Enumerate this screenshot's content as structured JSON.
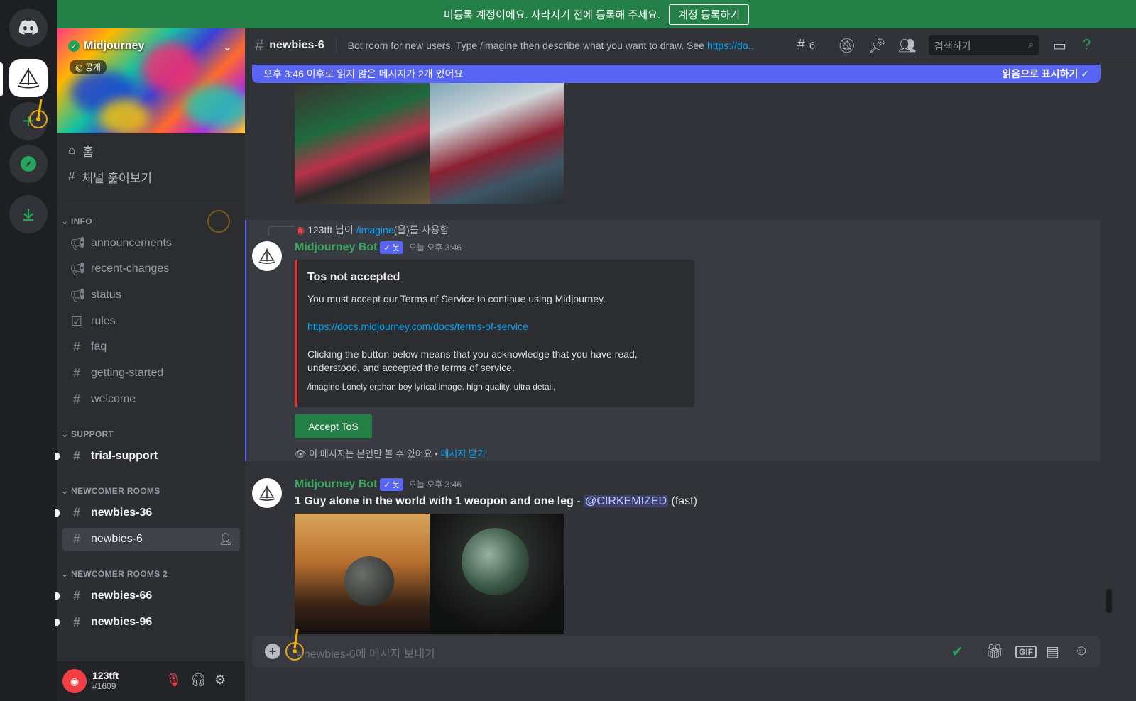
{
  "banner": {
    "text": "미등록 계정이에요. 사라지기 전에 등록해 주세요.",
    "button": "계정 등록하기"
  },
  "server": {
    "name": "Midjourney",
    "visibility": "공개"
  },
  "nav": {
    "home": "홈",
    "browse": "채널 훑어보기"
  },
  "categories": {
    "info": "INFO",
    "support": "SUPPORT",
    "newcomer": "NEWCOMER ROOMS",
    "newcomer2": "NEWCOMER ROOMS 2"
  },
  "channels": {
    "info": [
      "announcements",
      "recent-changes",
      "status",
      "rules",
      "faq",
      "getting-started",
      "welcome"
    ],
    "support": [
      "trial-support"
    ],
    "newcomer": [
      "newbies-36",
      "newbies-6"
    ],
    "newcomer2": [
      "newbies-66",
      "newbies-96"
    ]
  },
  "user": {
    "name": "123tft",
    "discriminator": "#1609"
  },
  "topbar": {
    "channel": "newbies-6",
    "topic": "Bot room for new users. Type /imagine then describe what you want to draw. See ",
    "topic_link": "https://do...",
    "threads_count": "6",
    "search_placeholder": "검색하기"
  },
  "unread": {
    "text": "오후 3:46 이후로 읽지 않은 메시지가 2개 있어요",
    "action": "읽음으로 표시하기"
  },
  "messages": [
    {
      "reply_user": "123tft",
      "reply_suffix": " 님이 ",
      "reply_command": "/imagine",
      "reply_tail": "(을)를 사용함",
      "author": "Midjourney Bot",
      "badge": "✓ 봇",
      "time": "오늘 오후 3:46",
      "embed": {
        "title": "Tos not accepted",
        "line1": "You must accept our Terms of Service to continue using Midjourney.",
        "link": "https://docs.midjourney.com/docs/terms-of-service",
        "line2": "Clicking the button below means that you acknowledge that you have read, understood, and accepted the terms of service.",
        "command": "/imagine Lonely orphan boy lyrical image, high quality, ultra detail,"
      },
      "button": "Accept ToS",
      "ephemeral": "이 메시지는 본인만 볼 수 있어요 • ",
      "dismiss": "메시지 닫기"
    },
    {
      "author": "Midjourney Bot",
      "badge": "✓ 봇",
      "time": "오늘 오후 3:46",
      "prompt": "1 Guy alone in the world with 1 weopon and one leg",
      "sep": " - ",
      "mention": "@CIRKEMIZED",
      "speed": " (fast)"
    }
  ],
  "composer": {
    "placeholder": "#newbies-6에 메시지 보내기"
  }
}
